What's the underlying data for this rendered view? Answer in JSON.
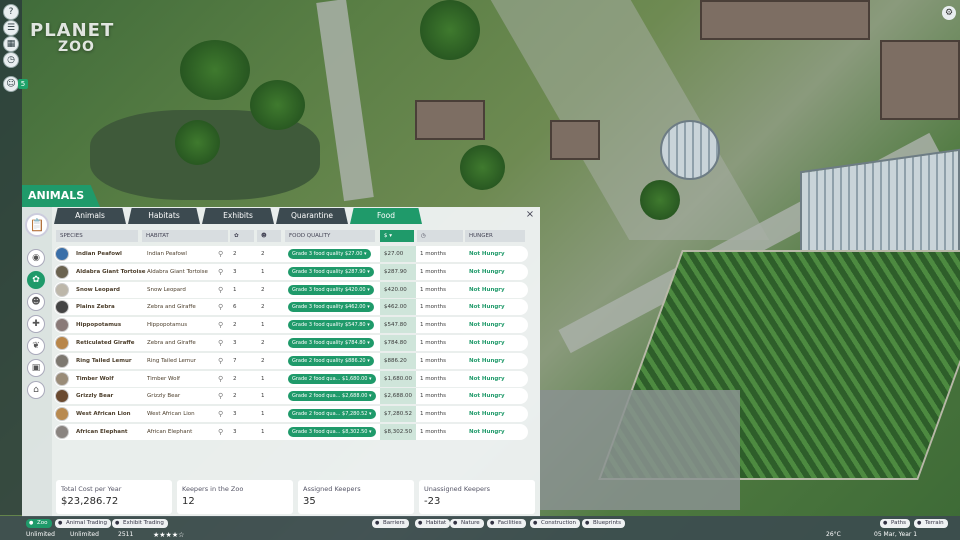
{
  "app": {
    "logo_top": "PLANET",
    "logo_bottom": "ZOO"
  },
  "left_rail": {
    "items": [
      "?",
      "☰",
      "▦",
      "◷",
      "☺"
    ],
    "badge": "5"
  },
  "panel": {
    "title": "ANIMALS",
    "tabs": [
      "Animals",
      "Habitats",
      "Exhibits",
      "Quarantine",
      "Food"
    ],
    "active_tab": "Food",
    "close_glyph": "×",
    "columns": {
      "species": "SPECIES",
      "habitat": "HABITAT",
      "food_quality": "FOOD QUALITY",
      "cost": "$ ▾",
      "time": "◷",
      "hunger": "HUNGER"
    },
    "rows": [
      {
        "species": "Indian Peafowl",
        "habitat": "Indian Peafowl",
        "n1": "2",
        "n2": "2",
        "quality": "Grade 3 food quality $27.00 ▾",
        "cost": "$27.00",
        "months": "1 months",
        "hunger": "Not Hungry",
        "color": "#3b6fa8"
      },
      {
        "species": "Aldabra Giant Tortoise",
        "habitat": "Aldabra Giant Tortoise",
        "n1": "3",
        "n2": "1",
        "quality": "Grade 3 food quality $287.90 ▾",
        "cost": "$287.90",
        "months": "1 months",
        "hunger": "Not Hungry",
        "color": "#6b6350"
      },
      {
        "species": "Snow Leopard",
        "habitat": "Snow Leopard",
        "n1": "1",
        "n2": "2",
        "quality": "Grade 3 food quality $420.00 ▾",
        "cost": "$420.00",
        "months": "1 months",
        "hunger": "Not Hungry",
        "color": "#bdb7aa"
      },
      {
        "species": "Plains Zebra",
        "habitat": "Zebra and Giraffe",
        "n1": "6",
        "n2": "2",
        "quality": "Grade 3 food quality $462.00 ▾",
        "cost": "$462.00",
        "months": "1 months",
        "hunger": "Not Hungry",
        "color": "#444444"
      },
      {
        "species": "Hippopotamus",
        "habitat": "Hippopotamus",
        "n1": "2",
        "n2": "1",
        "quality": "Grade 3 food quality $547.80 ▾",
        "cost": "$547.80",
        "months": "1 months",
        "hunger": "Not Hungry",
        "color": "#8a7a78"
      },
      {
        "species": "Reticulated Giraffe",
        "habitat": "Zebra and Giraffe",
        "n1": "3",
        "n2": "2",
        "quality": "Grade 3 food quality $784.80 ▾",
        "cost": "$784.80",
        "months": "1 months",
        "hunger": "Not Hungry",
        "color": "#b8864a"
      },
      {
        "species": "Ring Tailed Lemur",
        "habitat": "Ring Tailed Lemur",
        "n1": "7",
        "n2": "2",
        "quality": "Grade 2 food quality $886.20 ▾",
        "cost": "$886.20",
        "months": "1 months",
        "hunger": "Not Hungry",
        "color": "#7d7870"
      },
      {
        "species": "Timber Wolf",
        "habitat": "Timber Wolf",
        "n1": "2",
        "n2": "1",
        "quality": "Grade 2 food qua... $1,680.00 ▾",
        "cost": "$1,680.00",
        "months": "1 months",
        "hunger": "Not Hungry",
        "color": "#9a8c78"
      },
      {
        "species": "Grizzly Bear",
        "habitat": "Grizzly Bear",
        "n1": "2",
        "n2": "1",
        "quality": "Grade 2 food qua... $2,688.00 ▾",
        "cost": "$2,688.00",
        "months": "1 months",
        "hunger": "Not Hungry",
        "color": "#6a4a30"
      },
      {
        "species": "West African Lion",
        "habitat": "West African Lion",
        "n1": "3",
        "n2": "1",
        "quality": "Grade 2 food qua... $7,280.52 ▾",
        "cost": "$7,280.52",
        "months": "1 months",
        "hunger": "Not Hungry",
        "color": "#b88a50"
      },
      {
        "species": "African Elephant",
        "habitat": "African Elephant",
        "n1": "3",
        "n2": "1",
        "quality": "Grade 3 food qua... $8,302.50 ▾",
        "cost": "$8,302.50",
        "months": "1 months",
        "hunger": "Not Hungry",
        "color": "#8a8480"
      }
    ],
    "summary": [
      {
        "label": "Total Cost per Year",
        "value": "$23,286.72"
      },
      {
        "label": "Keepers in the Zoo",
        "value": "12"
      },
      {
        "label": "Assigned Keepers",
        "value": "35"
      },
      {
        "label": "Unassigned Keepers",
        "value": "-23"
      }
    ]
  },
  "bottom_bar": {
    "left_buttons": [
      "Zoo",
      "Animal Trading",
      "Exhibit Trading"
    ],
    "center_buttons": [
      "Barriers",
      "Habitat",
      "Nature",
      "Facilities",
      "Construction",
      "Blueprints"
    ],
    "right_buttons": [
      "Paths",
      "Terrain"
    ],
    "money": "Unlimited",
    "research": "Unlimited",
    "guests": "2511",
    "stars": "★★★★☆",
    "temperature": "26°C",
    "date": "05 Mar, Year 1"
  },
  "colors": {
    "accent": "#1f9a6a",
    "tab_dark": "#3c4a50"
  }
}
